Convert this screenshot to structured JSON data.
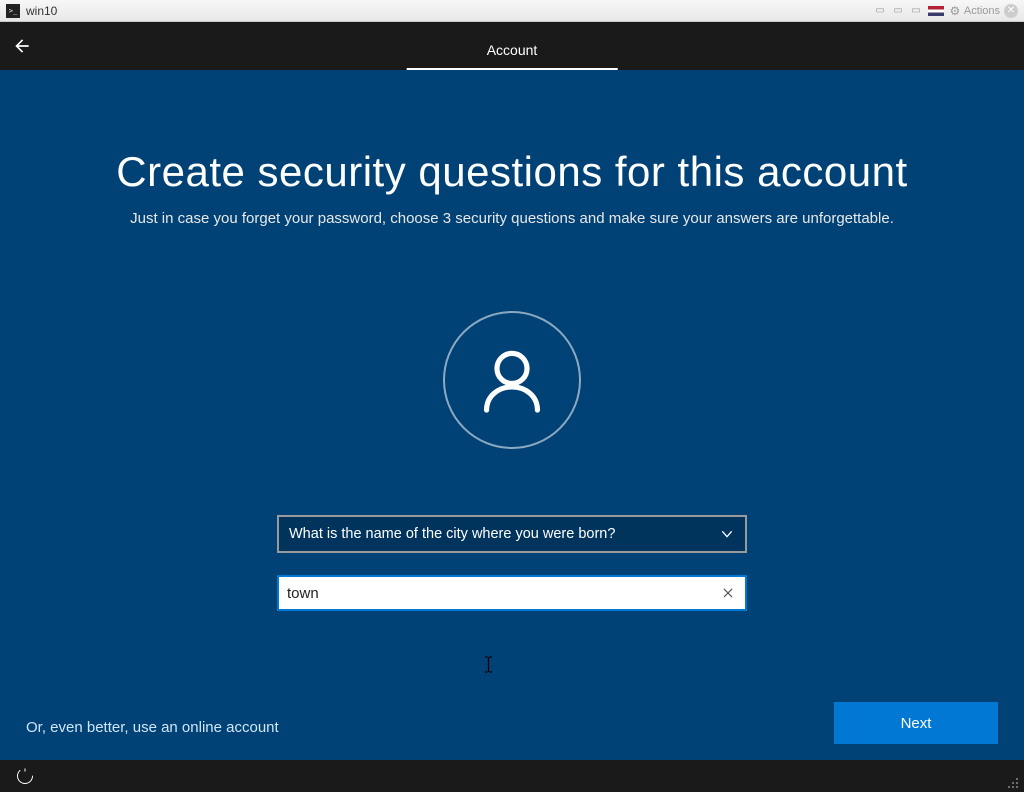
{
  "vm": {
    "title": "win10",
    "actions_label": "Actions"
  },
  "header": {
    "tab_label": "Account"
  },
  "main": {
    "title": "Create security questions for this account",
    "subtitle": "Just in case you forget your password, choose 3 security questions and make sure your answers are unforgettable.",
    "security_question_selected": "What is the name of the city where you were born?",
    "answer_value": "town",
    "online_account_link": "Or, even better, use an online account",
    "next_label": "Next"
  }
}
